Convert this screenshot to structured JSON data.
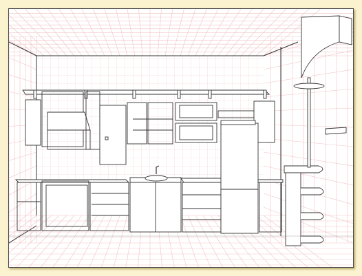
{
  "colors": {
    "background_frame": "#fbf3cf",
    "canvas": "#ffffff",
    "grid": "#f2c3c6",
    "line": "#222222"
  },
  "icons": [
    "kitchen-drawing",
    "perspective-grid"
  ]
}
